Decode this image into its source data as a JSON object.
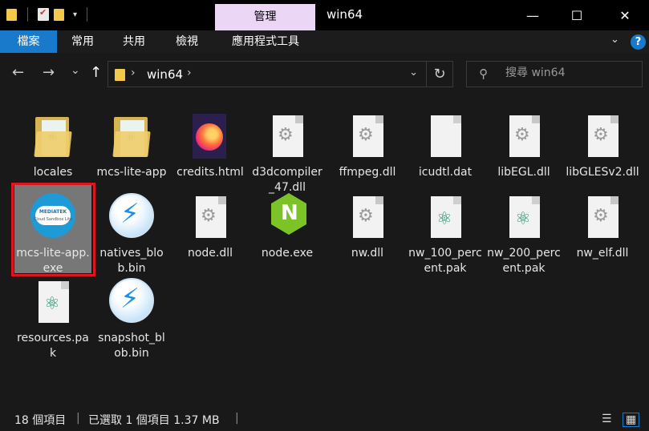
{
  "title_bar": {
    "manage_tab": "管理",
    "window_title": "win64",
    "minimize": "—",
    "maximize": "☐",
    "close": "✕"
  },
  "ribbon": {
    "tabs": [
      "檔案",
      "常用",
      "共用",
      "檢視",
      "應用程式工具"
    ],
    "help": "?"
  },
  "nav": {
    "back": "←",
    "forward": "→",
    "recent": "⌄",
    "up": "↑",
    "address_path": "win64",
    "refresh": "↻",
    "search_placeholder": "搜尋 win64"
  },
  "files": [
    {
      "name": "locales",
      "icon": "folder-icon"
    },
    {
      "name": "mcs-lite-app",
      "icon": "folder-icon"
    },
    {
      "name": "credits.html",
      "icon": "firefox-html-icon"
    },
    {
      "name": "d3dcompiler_47.dll",
      "icon": "dll-icon"
    },
    {
      "name": "ffmpeg.dll",
      "icon": "dll-icon"
    },
    {
      "name": "icudtl.dat",
      "icon": "file-icon"
    },
    {
      "name": "libEGL.dll",
      "icon": "dll-icon"
    },
    {
      "name": "libGLESv2.dll",
      "icon": "dll-icon"
    },
    {
      "name": "mcs-lite-app.exe",
      "icon": "mcs-app-icon",
      "selected": true,
      "logo_text": "MEDIATEK",
      "logo_sub": "Cloud Sandbox Lite"
    },
    {
      "name": "natives_blob.bin",
      "icon": "bin-icon"
    },
    {
      "name": "node.dll",
      "icon": "dll-icon"
    },
    {
      "name": "node.exe",
      "icon": "nodejs-icon"
    },
    {
      "name": "nw.dll",
      "icon": "dll-icon"
    },
    {
      "name": "nw_100_percent.pak",
      "icon": "atom-pak-icon"
    },
    {
      "name": "nw_200_percent.pak",
      "icon": "atom-pak-icon"
    },
    {
      "name": "nw_elf.dll",
      "icon": "dll-icon"
    },
    {
      "name": "resources.pak",
      "icon": "atom-pak-icon"
    },
    {
      "name": "snapshot_blob.bin",
      "icon": "bin-icon"
    }
  ],
  "status": {
    "item_count": "18 個項目",
    "selection": "已選取 1 個項目  1.37 MB"
  },
  "colors": {
    "accent": "#1979ca",
    "manage_tab": "#ebd7f5",
    "selection_frame": "#e0141f",
    "background": "#191919"
  }
}
